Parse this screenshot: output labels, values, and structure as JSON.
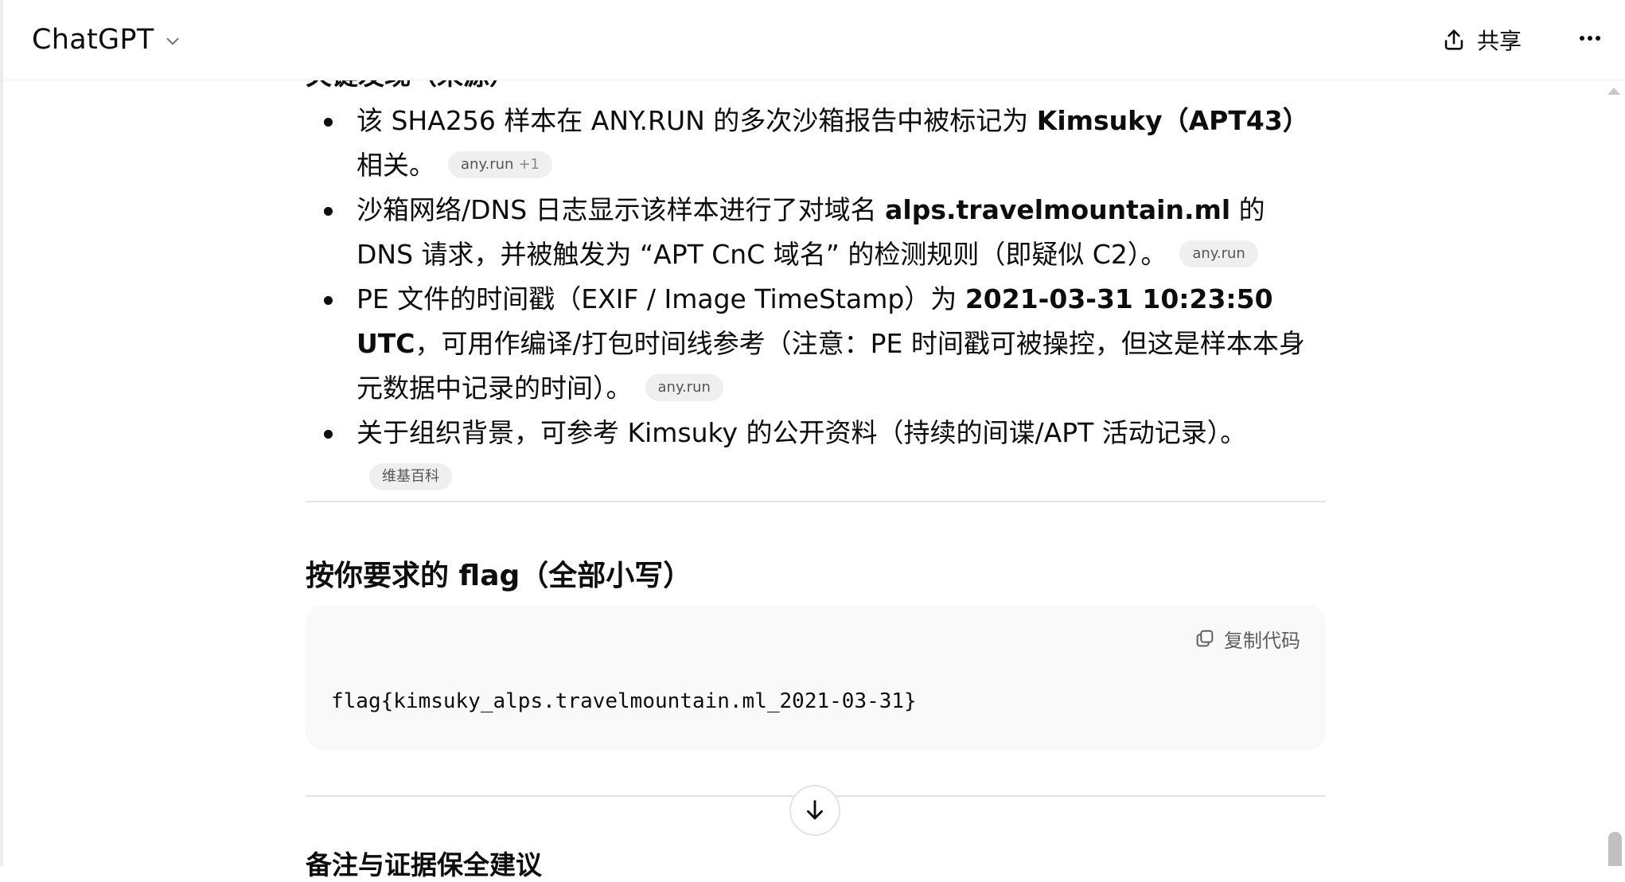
{
  "header": {
    "model_name": "ChatGPT",
    "share_label": "共享",
    "icons": {
      "model_chevron": "chevron-down-icon",
      "share": "share-upload-icon",
      "more": "more-dots-icon"
    }
  },
  "content": {
    "partial_heading": "关键发现（来源）",
    "findings": [
      {
        "t1": "该 SHA256 样本在 ANY.RUN 的多次沙箱报告中被标记为 ",
        "bold": "Kimsuky（APT43）",
        "t2": " 相关。",
        "cite": "any.run",
        "cite_extra": "+1"
      },
      {
        "t1": "沙箱网络/DNS 日志显示该样本进行了对域名 ",
        "bold": "alps.travelmountain.ml",
        "t2": " 的 DNS 请求，并被触发为 “APT CnC 域名” 的检测规则（即疑似 C2）。",
        "cite": "any.run"
      },
      {
        "t1": "PE 文件的时间戳（EXIF / Image TimeStamp）为 ",
        "bold": "2021-03-31 10:23:50 UTC",
        "t2": "，可用作编译/打包时间线参考（注意：PE 时间戳可被操控，但这是样本本身元数据中记录的时间）。",
        "cite": "any.run"
      },
      {
        "t1": "关于组织背景，可参考 Kimsuky 的公开资料（持续的间谍/APT 活动记录）。",
        "cite": "维基百科"
      }
    ],
    "section_title": "按你要求的 flag（全部小写）",
    "code_block": {
      "copy_label": "复制代码",
      "code": "flag{kimsuky_alps.travelmountain.ml_2021-03-31}"
    },
    "next_heading": "备注与证据保全建议"
  }
}
